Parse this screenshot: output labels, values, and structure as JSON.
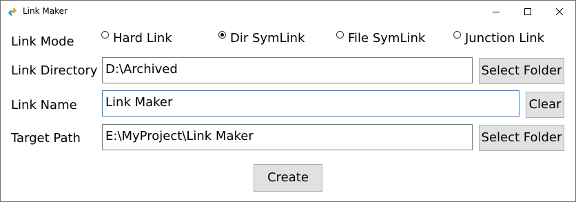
{
  "window": {
    "title": "Link Maker",
    "icon": "link-icon",
    "controls": [
      "minimize-icon",
      "maximize-icon",
      "close-icon"
    ]
  },
  "link_mode": {
    "label": "Link Mode",
    "options": [
      {
        "label": "Hard Link",
        "checked": false
      },
      {
        "label": "Dir SymLink",
        "checked": true
      },
      {
        "label": "File SymLink",
        "checked": false
      },
      {
        "label": "Junction Link",
        "checked": false
      }
    ]
  },
  "link_directory": {
    "label": "Link Directory",
    "value": "D:\\Archived",
    "button": "Select Folder"
  },
  "link_name": {
    "label": "Link Name",
    "value": "Link Maker",
    "button": "Clear"
  },
  "target_path": {
    "label": "Target Path",
    "value": "E:\\MyProject\\Link Maker",
    "button": "Select Folder"
  },
  "create_button": "Create"
}
